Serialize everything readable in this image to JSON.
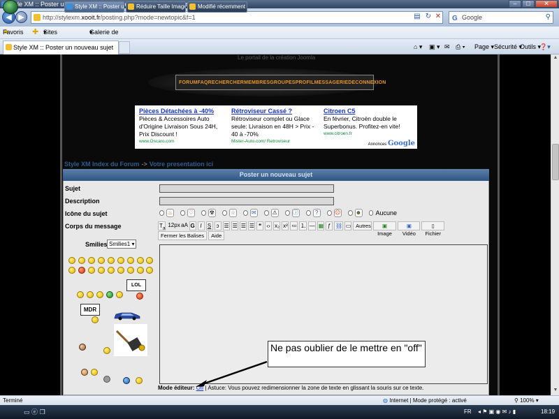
{
  "window": {
    "title": "Style XM :: Poster un nouveau sujet - Windows Internet Explorer"
  },
  "address": {
    "url_prefix": "http://stylexm.",
    "url_domain": "xooit.fr",
    "url_suffix": "/posting.php?mode=newtopic&f=1",
    "search_placeholder": "Google"
  },
  "favorites_bar": {
    "favorites_label": "Favoris",
    "suggested_sites": "Sites suggérés",
    "gallery": "Galerie de composants ..."
  },
  "tabs": {
    "active_label": "Style XM :: Poster un nouveau sujet"
  },
  "command_bar": {
    "page": "Page",
    "security": "Sécurité",
    "tools": "Outils"
  },
  "site": {
    "tagline": "Le portail de la création Joomla",
    "nav": [
      "FORUM",
      "FAQ",
      "RECHERCHER",
      "MEMBRES",
      "GROUPES",
      "PROFIL",
      "MESSAGERIE",
      "DECONNEXION"
    ]
  },
  "ads": [
    {
      "title": "Pièces Détachées à -40%",
      "desc": "Pièces & Accessoires Auto d'Origine Livraison Sous 24H, Prix Discount !",
      "url": "www.Oscaro.com"
    },
    {
      "title": "Rétroviseur Cassé ?",
      "desc": "Rétroviseur complet ou Glace seule: Livraison en 48H > Prix - 40 à -70%",
      "url": "Mister-Auto.com/ Retroviseur"
    },
    {
      "title": "Citroen C5",
      "desc": "En février, Citroën double le Superbonus. Profitez-en vite!",
      "url": "www.citroen.fr"
    }
  ],
  "ads_label": {
    "prefix": "Annonces",
    "brand": "Google"
  },
  "breadcrumb": {
    "forum_index": "Style XM Index du Forum",
    "separator": "->",
    "forum": "Votre presentation ici"
  },
  "form": {
    "header": "Poster un nouveau sujet",
    "subject_label": "Sujet",
    "description_label": "Description",
    "icon_label": "Icône du sujet",
    "body_label": "Corps du message",
    "icon_none": "Aucune",
    "smilies_label": "Smilies:",
    "smilies_select": "Smilies1",
    "toolbar": {
      "font_size": "12px",
      "bold": "G",
      "italic": "I",
      "underline": "S",
      "autres": "Autres",
      "image": "Image",
      "video": "Vidéo",
      "fichier": "Fichier",
      "close_tags": "Fermer les Balises",
      "help": "Aide"
    },
    "sign_lol": "LOL",
    "sign_mdr": "MDR",
    "editor_mode_label": "Mode éditeur:",
    "editor_mode_value": "Off",
    "editor_tip": "| Astuce: Vous pouvez redimensionner la zone de texte en glissant la souris sur ce texte."
  },
  "annotation": {
    "text": "Ne pas oublier de le mettre en \"off\""
  },
  "statusbar": {
    "left": "Terminé",
    "zone": "Internet | Mode protégé : activé",
    "zoom": "100%"
  },
  "taskbar": {
    "tasks": [
      "Style XM :: Poster u...",
      "Réduire Taille Image...",
      "Modifié récemment"
    ],
    "lang": "FR",
    "clock": "18:19"
  }
}
